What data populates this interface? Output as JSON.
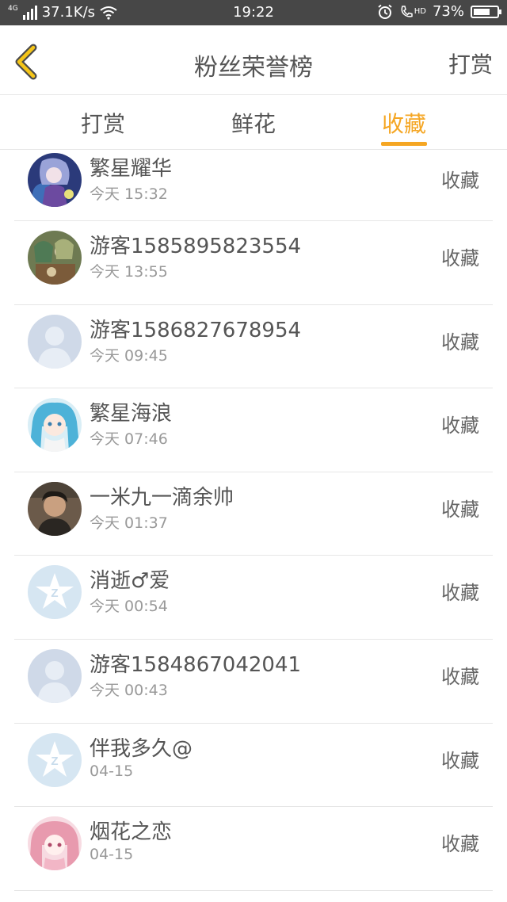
{
  "status_bar": {
    "network_type": "4G",
    "speed": "37.1K/s",
    "time": "19:22",
    "hd_label": "HD",
    "battery": "73%",
    "battery_level": 0.73
  },
  "header": {
    "title": "粉丝荣誉榜",
    "right_action": "打赏"
  },
  "tabs": [
    {
      "label": "打赏",
      "active": false
    },
    {
      "label": "鲜花",
      "active": false
    },
    {
      "label": "收藏",
      "active": true
    }
  ],
  "accent_color": "#f5a623",
  "list": [
    {
      "name": "繁星耀华",
      "time": "今天 15:32",
      "action": "收藏",
      "avatar": "anime-purple"
    },
    {
      "name": "游客1585895823554",
      "time": "今天 13:55",
      "action": "收藏",
      "avatar": "anime-group"
    },
    {
      "name": "游客1586827678954",
      "time": "今天 09:45",
      "action": "收藏",
      "avatar": "default-person"
    },
    {
      "name": "繁星海浪",
      "time": "今天 07:46",
      "action": "收藏",
      "avatar": "anime-blue"
    },
    {
      "name": "一米九一滴余帅",
      "time": "今天 01:37",
      "action": "收藏",
      "avatar": "photo-person"
    },
    {
      "name": "消逝♂爱",
      "time": "今天 00:54",
      "action": "收藏",
      "avatar": "qq-star"
    },
    {
      "name": "游客1584867042041",
      "time": "今天 00:43",
      "action": "收藏",
      "avatar": "default-person"
    },
    {
      "name": "伴我多久@",
      "time": "04-15",
      "action": "收藏",
      "avatar": "qq-star"
    },
    {
      "name": "烟花之恋",
      "time": "04-15",
      "action": "收藏",
      "avatar": "anime-pink"
    }
  ]
}
